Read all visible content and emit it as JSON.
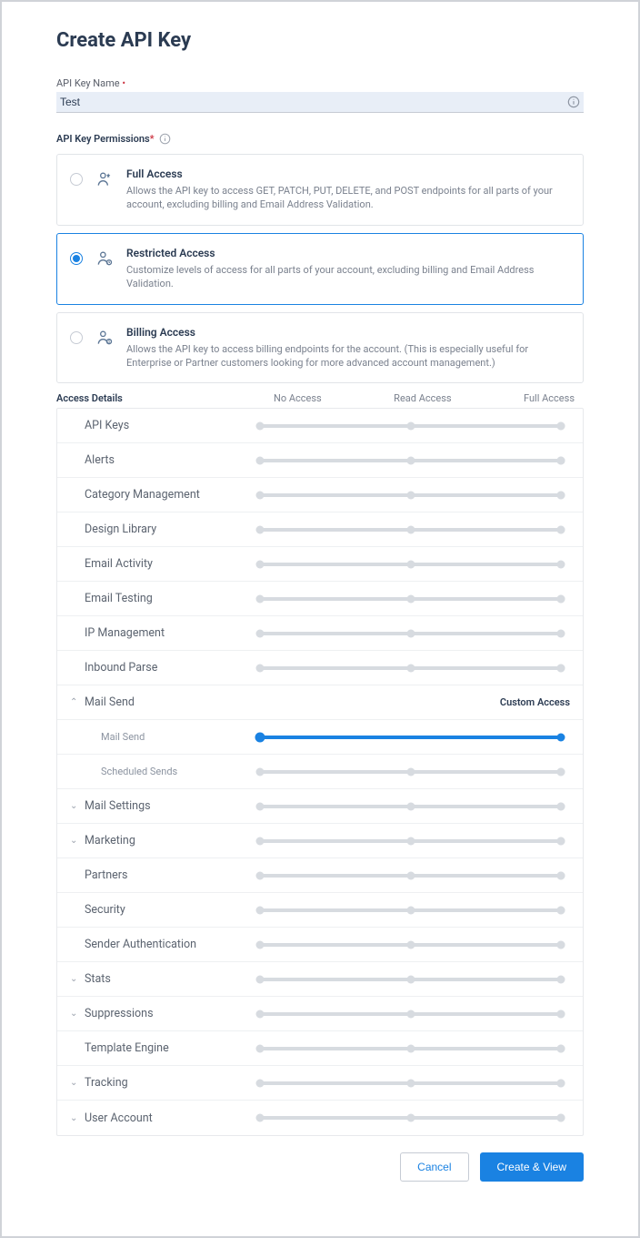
{
  "title": "Create API Key",
  "name_field": {
    "label": "API Key Name",
    "value": "Test"
  },
  "perm_label": "API Key Permissions",
  "options": [
    {
      "title": "Full Access",
      "desc": "Allows the API key to access GET, PATCH, PUT, DELETE, and POST endpoints for all parts of your account, excluding billing and Email Address Validation.",
      "selected": false
    },
    {
      "title": "Restricted Access",
      "desc": "Customize levels of access for all parts of your account, excluding billing and Email Address Validation.",
      "selected": true
    },
    {
      "title": "Billing Access",
      "desc": "Allows the API key to access billing endpoints for the account. (This is especially useful for Enterprise or Partner customers looking for more advanced account management.)",
      "selected": false
    }
  ],
  "access_header": {
    "title": "Access Details",
    "cols": [
      "No Access",
      "Read Access",
      "Full Access"
    ]
  },
  "details": [
    {
      "label": "API Keys",
      "level": 2,
      "stops": 3,
      "expandable": false
    },
    {
      "label": "Alerts",
      "level": 2,
      "stops": 3,
      "expandable": false
    },
    {
      "label": "Category Management",
      "level": 2,
      "stops": 3,
      "expandable": false
    },
    {
      "label": "Design Library",
      "level": 2,
      "stops": 3,
      "expandable": false
    },
    {
      "label": "Email Activity",
      "level": 1,
      "stops": 2,
      "expandable": false
    },
    {
      "label": "Email Testing",
      "level": 2,
      "stops": 3,
      "expandable": false
    },
    {
      "label": "IP Management",
      "level": 1,
      "stops": 2,
      "expandable": false
    },
    {
      "label": "Inbound Parse",
      "level": 2,
      "stops": 3,
      "expandable": false
    },
    {
      "label": "Mail Send",
      "custom": "Custom Access",
      "expanded": true,
      "children": [
        {
          "label": "Mail Send",
          "level": 2,
          "stops": 2,
          "active": true
        },
        {
          "label": "Scheduled Sends",
          "level": 2,
          "stops": 3,
          "active": false
        }
      ]
    },
    {
      "label": "Mail Settings",
      "level": 2,
      "stops": 3,
      "expandable": true
    },
    {
      "label": "Marketing",
      "level": 2,
      "stops": 3,
      "expandable": true
    },
    {
      "label": "Partners",
      "level": 2,
      "stops": 3,
      "expandable": false
    },
    {
      "label": "Security",
      "level": 2,
      "stops": 3,
      "expandable": false
    },
    {
      "label": "Sender Authentication",
      "level": 2,
      "stops": 3,
      "expandable": false
    },
    {
      "label": "Stats",
      "level": 1,
      "stops": 2,
      "expandable": true
    },
    {
      "label": "Suppressions",
      "level": 2,
      "stops": 3,
      "expandable": true
    },
    {
      "label": "Template Engine",
      "level": 2,
      "stops": 3,
      "expandable": false
    },
    {
      "label": "Tracking",
      "level": 2,
      "stops": 3,
      "expandable": true
    },
    {
      "label": "User Account",
      "level": 2,
      "stops": 3,
      "expandable": true
    }
  ],
  "buttons": {
    "cancel": "Cancel",
    "submit": "Create & View"
  }
}
